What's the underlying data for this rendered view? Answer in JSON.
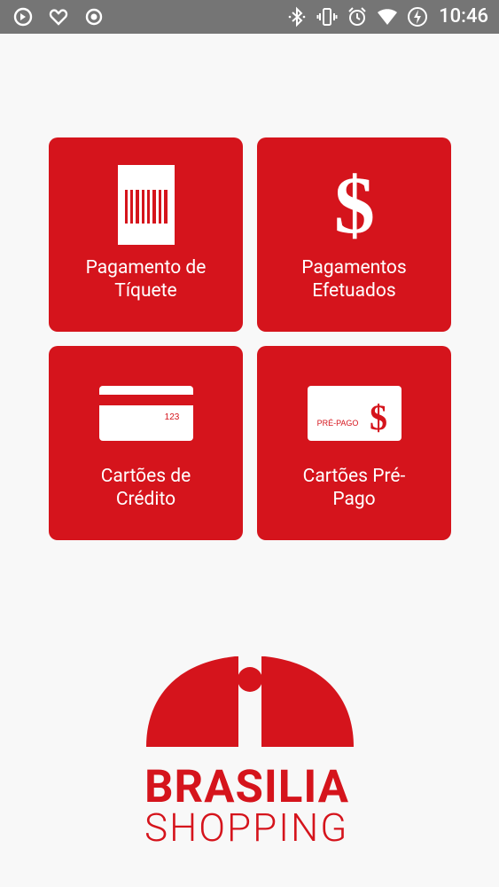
{
  "status_bar": {
    "time": "10:46",
    "left_icons": [
      "sync-icon",
      "heart-icon",
      "record-icon"
    ],
    "right_icons": [
      "bluetooth-icon",
      "vibrate-icon",
      "alarm-icon",
      "wifi-icon",
      "battery-charging-icon"
    ]
  },
  "menu": {
    "items": [
      {
        "label": "Pagamento de\nTíquete",
        "icon": "barcode-ticket-icon"
      },
      {
        "label": "Pagamentos\nEfetuados",
        "icon": "dollar-icon"
      },
      {
        "label": "Cartões de\nCrédito",
        "icon": "credit-card-icon",
        "card_number": "123"
      },
      {
        "label": "Cartões Pré-\nPago",
        "icon": "prepaid-card-icon",
        "card_text": "PRÉ-PAGO",
        "card_symbol": "$"
      }
    ]
  },
  "logo": {
    "line1": "BRASILIA",
    "line2": "SHOPPING",
    "color": "#d5141c"
  },
  "colors": {
    "accent": "#d5141c",
    "background": "#f8f8f8",
    "status_bar": "#757575"
  }
}
